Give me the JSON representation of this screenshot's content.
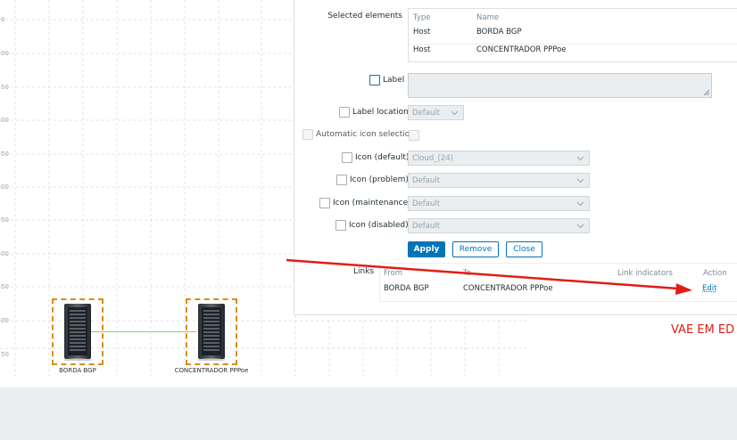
{
  "map": {
    "axis_ticks": [
      "0",
      "00",
      "50",
      "00",
      "50",
      "00",
      "50",
      "00",
      "50",
      "00",
      "50"
    ],
    "hosts": [
      {
        "name": "BORDA BGP"
      },
      {
        "name": "CONCENTRADOR PPPoe"
      }
    ]
  },
  "form": {
    "selected_elements_label": "Selected elements",
    "table_headers": {
      "type": "Type",
      "name": "Name"
    },
    "rows": [
      {
        "type": "Host",
        "name": "BORDA BGP"
      },
      {
        "type": "Host",
        "name": "CONCENTRADOR PPPoe"
      }
    ],
    "label_label": "Label",
    "label_location_label": "Label location",
    "label_location_value": "Default",
    "auto_icon_label": "Automatic icon selection",
    "icon_default_label": "Icon (default)",
    "icon_default_value": "Cloud_(24)",
    "icon_problem_label": "Icon (problem)",
    "icon_problem_value": "Default",
    "icon_maintenance_label": "Icon (maintenance)",
    "icon_maintenance_value": "Default",
    "icon_disabled_label": "Icon (disabled)",
    "icon_disabled_value": "Default",
    "apply_label": "Apply",
    "remove_label": "Remove",
    "close_label": "Close"
  },
  "links": {
    "section_label": "Links",
    "headers": {
      "from": "From",
      "to": "To",
      "indicators": "Link indicators",
      "action": "Action"
    },
    "rows": [
      {
        "from": "BORDA BGP",
        "to": "CONCENTRADOR PPPoe",
        "indicators": "",
        "action": "Edit"
      }
    ]
  },
  "annotation": {
    "text": "VAE EM ED",
    "color": "#e01d16"
  },
  "colors": {
    "accent": "#0275b8",
    "selection_dash": "#d98c1a",
    "link_line": "#7ed37e"
  }
}
